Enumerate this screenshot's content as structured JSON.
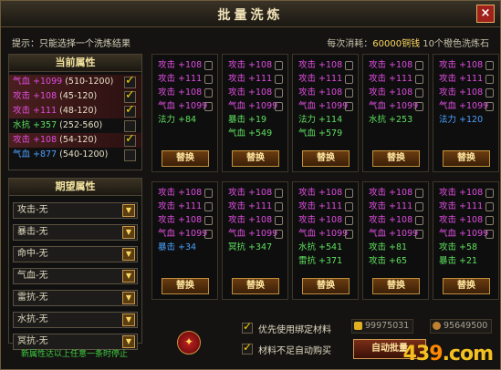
{
  "title": "批量洗炼",
  "hint": "提示：只能选择一个洗炼结果",
  "cost": {
    "prefix": "每次消耗：",
    "coins": "60000铜钱",
    "stones": "10个橙色洗炼石"
  },
  "current": {
    "header": "当前属性",
    "rows": [
      {
        "text": "气血 +1099",
        "range": "(510-1200)",
        "checked": true
      },
      {
        "text": "攻击 +108",
        "range": "(45-120)",
        "checked": true
      },
      {
        "text": "攻击 +111",
        "range": "(48-120)",
        "checked": true
      },
      {
        "text": "水抗 +357",
        "range": "(252-560)",
        "checked": false
      },
      {
        "text": "攻击 +108",
        "range": "(54-120)",
        "checked": true
      },
      {
        "text": "气血 +877",
        "range": "(540-1200)",
        "checked": false
      }
    ]
  },
  "desired": {
    "header": "期望属性",
    "selects": [
      "攻击-无",
      "暴击-无",
      "命中-无",
      "气血-无",
      "雷抗-无",
      "水抗-无",
      "冥抗-无"
    ]
  },
  "tip": "新属性达以上任意一条时停止",
  "cards": [
    {
      "lines": [
        [
          "攻击 +108",
          "p",
          1
        ],
        [
          "攻击 +111",
          "p",
          1
        ],
        [
          "攻击 +108",
          "p",
          1
        ],
        [
          "气血 +1099",
          "p",
          1
        ],
        [
          "法力 +84",
          "g",
          0
        ]
      ],
      "btn": "替换"
    },
    {
      "lines": [
        [
          "攻击 +108",
          "p",
          1
        ],
        [
          "攻击 +111",
          "p",
          1
        ],
        [
          "攻击 +108",
          "p",
          1
        ],
        [
          "气血 +1099",
          "p",
          1
        ],
        [
          "暴击 +19",
          "g",
          0
        ],
        [
          "气血 +549",
          "g",
          0
        ]
      ],
      "btn": "替换"
    },
    {
      "lines": [
        [
          "攻击 +108",
          "p",
          1
        ],
        [
          "攻击 +111",
          "p",
          1
        ],
        [
          "攻击 +108",
          "p",
          1
        ],
        [
          "气血 +1099",
          "p",
          1
        ],
        [
          "法力 +114",
          "g",
          0
        ],
        [
          "气血 +579",
          "g",
          0
        ]
      ],
      "btn": "替换"
    },
    {
      "lines": [
        [
          "攻击 +108",
          "p",
          1
        ],
        [
          "攻击 +111",
          "p",
          1
        ],
        [
          "攻击 +108",
          "p",
          1
        ],
        [
          "气血 +1099",
          "p",
          1
        ],
        [
          "水抗 +253",
          "g",
          0
        ]
      ],
      "btn": "替换"
    },
    {
      "lines": [
        [
          "攻击 +108",
          "p",
          1
        ],
        [
          "攻击 +111",
          "p",
          1
        ],
        [
          "攻击 +108",
          "p",
          1
        ],
        [
          "气血 +1099",
          "p",
          1
        ],
        [
          "法力 +120",
          "b",
          0
        ]
      ],
      "btn": "替换"
    },
    {
      "lines": [
        [
          "攻击 +108",
          "p",
          1
        ],
        [
          "攻击 +111",
          "p",
          1
        ],
        [
          "攻击 +108",
          "p",
          1
        ],
        [
          "气血 +1099",
          "p",
          1
        ],
        [
          "暴击 +34",
          "b",
          0
        ]
      ],
      "btn": "替换"
    },
    {
      "lines": [
        [
          "攻击 +108",
          "p",
          1
        ],
        [
          "攻击 +111",
          "p",
          1
        ],
        [
          "攻击 +108",
          "p",
          1
        ],
        [
          "气血 +1099",
          "p",
          1
        ],
        [
          "冥抗 +347",
          "g",
          0
        ]
      ],
      "btn": "替换"
    },
    {
      "lines": [
        [
          "攻击 +108",
          "p",
          1
        ],
        [
          "攻击 +111",
          "p",
          1
        ],
        [
          "攻击 +108",
          "p",
          1
        ],
        [
          "气血 +1099",
          "p",
          1
        ],
        [
          "水抗 +541",
          "g",
          0
        ],
        [
          "雷抗 +371",
          "g",
          0
        ]
      ],
      "btn": "替换"
    },
    {
      "lines": [
        [
          "攻击 +108",
          "p",
          1
        ],
        [
          "攻击 +111",
          "p",
          1
        ],
        [
          "攻击 +108",
          "p",
          1
        ],
        [
          "气血 +1099",
          "p",
          1
        ],
        [
          "攻击 +81",
          "g",
          0
        ],
        [
          "攻击 +65",
          "g",
          0
        ]
      ],
      "btn": "替换"
    },
    {
      "lines": [
        [
          "攻击 +108",
          "p",
          1
        ],
        [
          "攻击 +111",
          "p",
          1
        ],
        [
          "攻击 +108",
          "p",
          1
        ],
        [
          "气血 +1099",
          "p",
          1
        ],
        [
          "攻击 +58",
          "g",
          0
        ],
        [
          "暴击 +21",
          "g",
          0
        ]
      ],
      "btn": "替换"
    }
  ],
  "options": {
    "bind_first": "优先使用绑定材料",
    "auto_buy": "材料不足自动购买"
  },
  "money": {
    "gold": "99975031",
    "silver": "95649500"
  },
  "auto_button": "自动批量",
  "logo": "4399"
}
